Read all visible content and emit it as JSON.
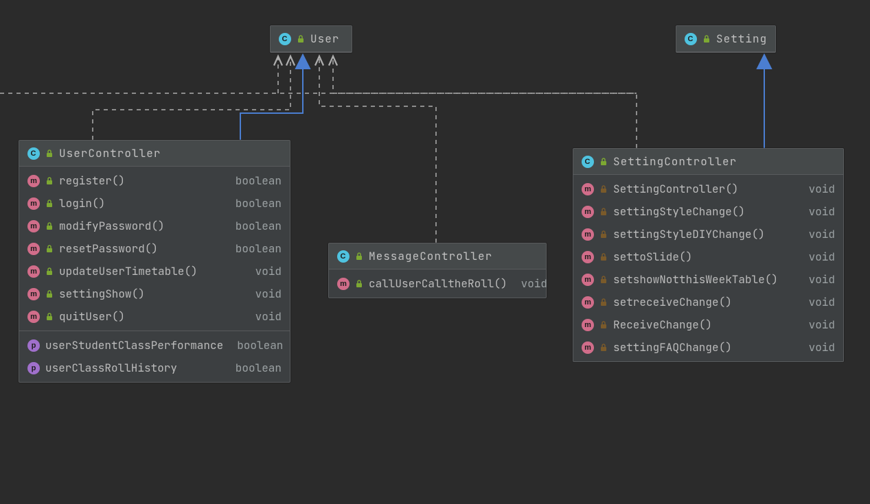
{
  "colors": {
    "bg": "#2b2b2b",
    "panel": "#3c3f41",
    "border": "#595b5d",
    "accentCyan": "#4fc3e0",
    "accentPink": "#d16d8a",
    "accentPurple": "#a070cc",
    "accentGreenLock": "#7da832",
    "accentBrownLock": "#7a5a2a",
    "arrowBlue": "#4b7ed1",
    "dashedGrey": "#aeaeae"
  },
  "relations": [
    {
      "from": "offscreen-left",
      "to": "User",
      "style": "dashed-dependency"
    },
    {
      "from": "UserController",
      "to": "User",
      "style": "dashed-dependency"
    },
    {
      "from": "UserController",
      "to": "User",
      "style": "solid-generalization"
    },
    {
      "from": "MessageController",
      "to": "User",
      "style": "dashed-dependency"
    },
    {
      "from": "SettingController",
      "to": "User",
      "style": "dashed-dependency"
    },
    {
      "from": "SettingController",
      "to": "Setting",
      "style": "solid-generalization"
    }
  ],
  "nodes": {
    "user": {
      "name": "User",
      "kind": "class"
    },
    "setting": {
      "name": "Setting",
      "kind": "class"
    },
    "userController": {
      "name": "UserController",
      "kind": "class",
      "methods": [
        {
          "name": "register()",
          "type": "boolean",
          "visibility": "public"
        },
        {
          "name": "login()",
          "type": "boolean",
          "visibility": "public"
        },
        {
          "name": "modifyPassword()",
          "type": "boolean",
          "visibility": "public"
        },
        {
          "name": "resetPassword()",
          "type": "boolean",
          "visibility": "public"
        },
        {
          "name": "updateUserTimetable()",
          "type": "void",
          "visibility": "public"
        },
        {
          "name": "settingShow()",
          "type": "void",
          "visibility": "public"
        },
        {
          "name": "quitUser()",
          "type": "void",
          "visibility": "public"
        }
      ],
      "properties": [
        {
          "name": "userStudentClassPerformance",
          "type": "boolean"
        },
        {
          "name": "userClassRollHistory",
          "type": "boolean"
        }
      ]
    },
    "messageController": {
      "name": "MessageController",
      "kind": "class",
      "methods": [
        {
          "name": "callUserCalltheRoll()",
          "type": "void",
          "visibility": "public"
        }
      ]
    },
    "settingController": {
      "name": "SettingController",
      "kind": "class",
      "methods": [
        {
          "name": "SettingController()",
          "type": "void",
          "visibility": "package"
        },
        {
          "name": "settingStyleChange()",
          "type": "void",
          "visibility": "package"
        },
        {
          "name": "settingStyleDIYChange()",
          "type": "void",
          "visibility": "package"
        },
        {
          "name": "settoSlide()",
          "type": "void",
          "visibility": "package"
        },
        {
          "name": "setshowNotthisWeekTable()",
          "type": "void",
          "visibility": "package"
        },
        {
          "name": "setreceiveChange()",
          "type": "void",
          "visibility": "package"
        },
        {
          "name": "ReceiveChange()",
          "type": "void",
          "visibility": "package"
        },
        {
          "name": "settingFAQChange()",
          "type": "void",
          "visibility": "package"
        }
      ]
    }
  }
}
